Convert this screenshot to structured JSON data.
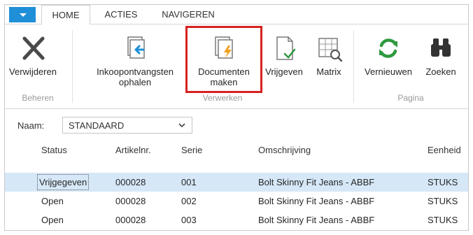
{
  "tabs": [
    {
      "label": "HOME",
      "active": true
    },
    {
      "label": "ACTIES",
      "active": false
    },
    {
      "label": "NAVIGEREN",
      "active": false
    }
  ],
  "ribbon": {
    "buttons": [
      {
        "id": "verwijderen",
        "label": "Verwijderen",
        "icon": "delete-x-icon"
      },
      {
        "id": "inkoop",
        "label": "Inkoopontvangsten\nophalen",
        "icon": "get-receipts-icon"
      },
      {
        "id": "documenten",
        "label": "Documenten\nmaken",
        "icon": "create-documents-icon"
      },
      {
        "id": "vrijgeven",
        "label": "Vrijgeven",
        "icon": "release-document-icon"
      },
      {
        "id": "matrix",
        "label": "Matrix",
        "icon": "matrix-icon"
      },
      {
        "id": "vernieuwen",
        "label": "Vernieuwen",
        "icon": "refresh-icon"
      },
      {
        "id": "zoeken",
        "label": "Zoeken",
        "icon": "binoculars-icon"
      }
    ],
    "groups": [
      "Beheren",
      "Verwerken",
      "Pagina"
    ]
  },
  "name_field": {
    "label": "Naam:",
    "value": "STANDAARD"
  },
  "table": {
    "columns": [
      "Status",
      "Artikelnr.",
      "Serie",
      "Omschrijving",
      "Eenheid"
    ],
    "rows": [
      {
        "status": "Vrijgegeven",
        "artikelnr": "000028",
        "serie": "001",
        "omschrijving": "Bolt Skinny Fit Jeans - ABBF",
        "eenheid": "STUKS"
      },
      {
        "status": "Open",
        "artikelnr": "000028",
        "serie": "002",
        "omschrijving": "Bolt Skinny Fit Jeans - ABBF",
        "eenheid": "STUKS"
      },
      {
        "status": "Open",
        "artikelnr": "000028",
        "serie": "003",
        "omschrijving": "Bolt Skinny Fit Jeans - ABBF",
        "eenheid": "STUKS"
      }
    ]
  },
  "colors": {
    "accent": "#1f8fd8",
    "highlight": "#d92121",
    "selected_row": "#d6e8f8",
    "refresh_green": "#2e9a3f"
  }
}
